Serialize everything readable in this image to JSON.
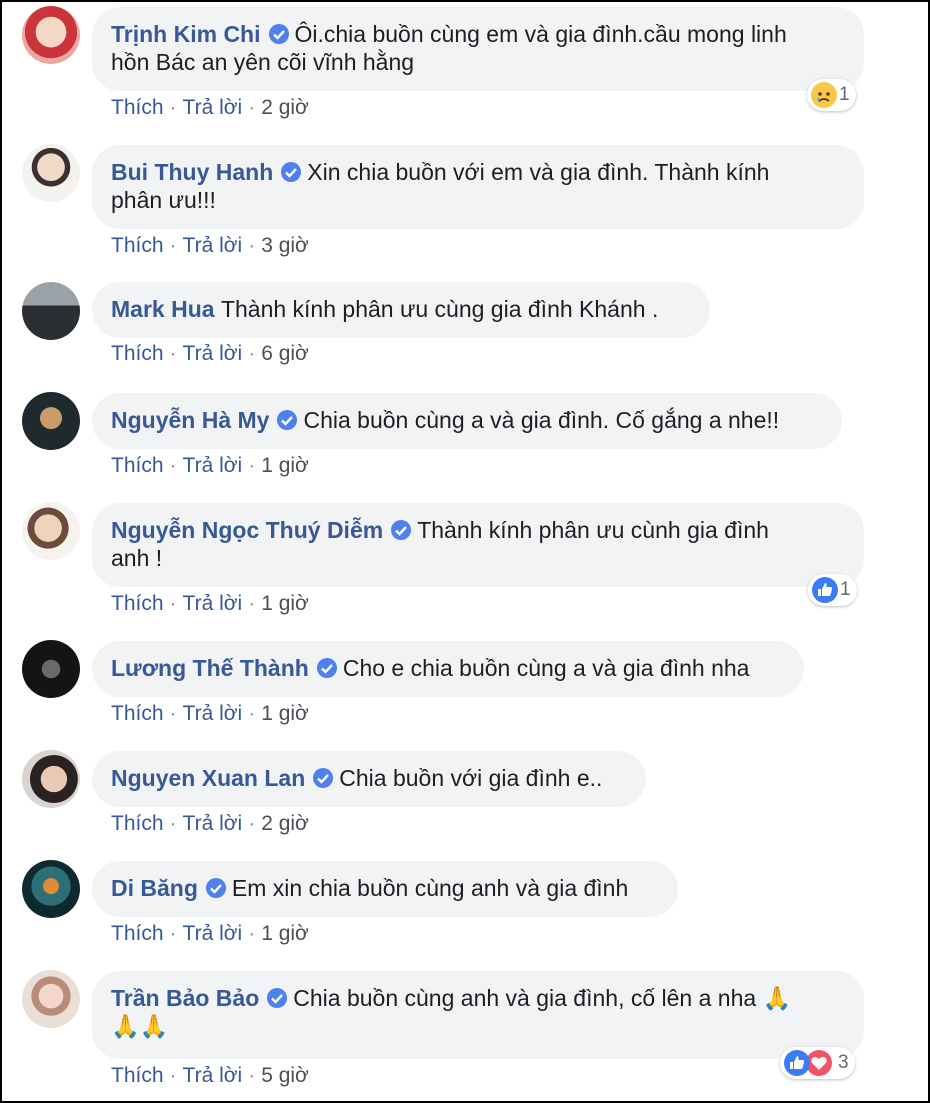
{
  "actions": {
    "like": "Thích",
    "reply": "Trả lời",
    "sep": "·"
  },
  "colors": {
    "name": "#385898",
    "bubble": "#f2f3f5",
    "verified": "#4e80ef",
    "like": "#3b7cf5",
    "love": "#f25268",
    "sad": "#f7c948"
  },
  "comments": [
    {
      "name": "Trịnh Kim Chi",
      "verified": true,
      "line1": "Ôi.chia buồn cùng em và gia đình.cầu mong linh",
      "line2": "hồn Bác an yên cõi vĩnh hằng",
      "time": "2 giờ",
      "reactions": [
        "sad-icon"
      ],
      "reaction_count": "1"
    },
    {
      "name": "Bui Thuy Hanh",
      "verified": true,
      "line1": "Xin chia buồn với em và gia đình. Thành kính",
      "line2": "phân ưu!!!",
      "time": "3 giờ"
    },
    {
      "name": "Mark Hua",
      "verified": false,
      "line1": "Thành kính phân ưu cùng gia đình Khánh .",
      "time": "6 giờ"
    },
    {
      "name": "Nguyễn Hà My",
      "verified": true,
      "line1": "Chia buồn cùng a và gia đình. Cố gắng a nhe!!",
      "time": "1 giờ"
    },
    {
      "name": "Nguyễn Ngọc Thuý Diễm",
      "verified": true,
      "line1": "Thành kính phân ưu cùnh gia đình",
      "line2": "anh !",
      "time": "1 giờ",
      "reactions": [
        "like-icon"
      ],
      "reaction_count": "1"
    },
    {
      "name": "Lương Thế Thành",
      "verified": true,
      "line1": "Cho e chia buồn cùng a và gia đình nha",
      "time": "1 giờ"
    },
    {
      "name": "Nguyen Xuan Lan",
      "verified": true,
      "line1": "Chia buồn với gia đình e..",
      "time": "2 giờ"
    },
    {
      "name": "Di Băng",
      "verified": true,
      "line1": "Em xin chia buồn cùng anh và gia đình",
      "time": "1 giờ"
    },
    {
      "name": "Trần Bảo Bảo",
      "verified": true,
      "line1": "Chia buồn cùng anh và gia đình, cố lên a nha 🙏",
      "line2": "🙏🙏",
      "time": "5 giờ",
      "reactions": [
        "like-icon",
        "love-icon"
      ],
      "reaction_count": "3"
    }
  ]
}
